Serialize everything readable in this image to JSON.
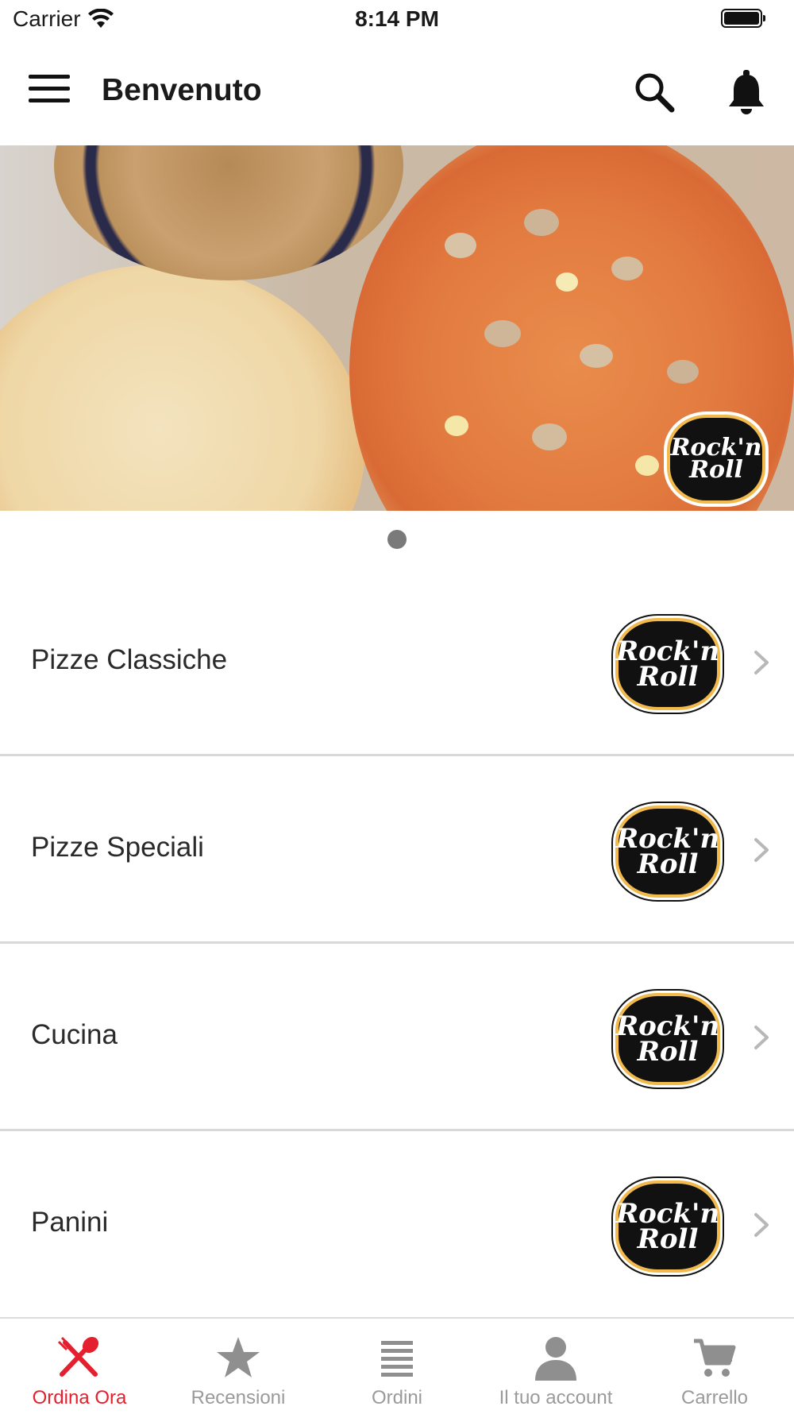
{
  "status_bar": {
    "carrier": "Carrier",
    "time": "8:14 PM"
  },
  "header": {
    "title": "Benvenuto"
  },
  "banner": {
    "brand_logo_lines": [
      "Rock'n",
      "Roll"
    ],
    "pages": 1,
    "current_page": 1
  },
  "categories": [
    {
      "label": "Pizze Classiche",
      "logo_lines": [
        "Rock'n",
        "Roll"
      ]
    },
    {
      "label": "Pizze Speciali",
      "logo_lines": [
        "Rock'n",
        "Roll"
      ]
    },
    {
      "label": "Cucina",
      "logo_lines": [
        "Rock'n",
        "Roll"
      ]
    },
    {
      "label": "Panini",
      "logo_lines": [
        "Rock'n",
        "Roll"
      ]
    }
  ],
  "tabbar": {
    "tabs": [
      {
        "label": "Ordina Ora",
        "icon": "utensils-icon",
        "active": true
      },
      {
        "label": "Recensioni",
        "icon": "star-icon",
        "active": false
      },
      {
        "label": "Ordini",
        "icon": "list-icon",
        "active": false
      },
      {
        "label": "Il tuo account",
        "icon": "user-icon",
        "active": false
      },
      {
        "label": "Carrello",
        "icon": "cart-icon",
        "active": false
      }
    ]
  },
  "colors": {
    "accent": "#e5202e",
    "inactive": "#9a9a9a",
    "divider": "#d9d9d9"
  }
}
